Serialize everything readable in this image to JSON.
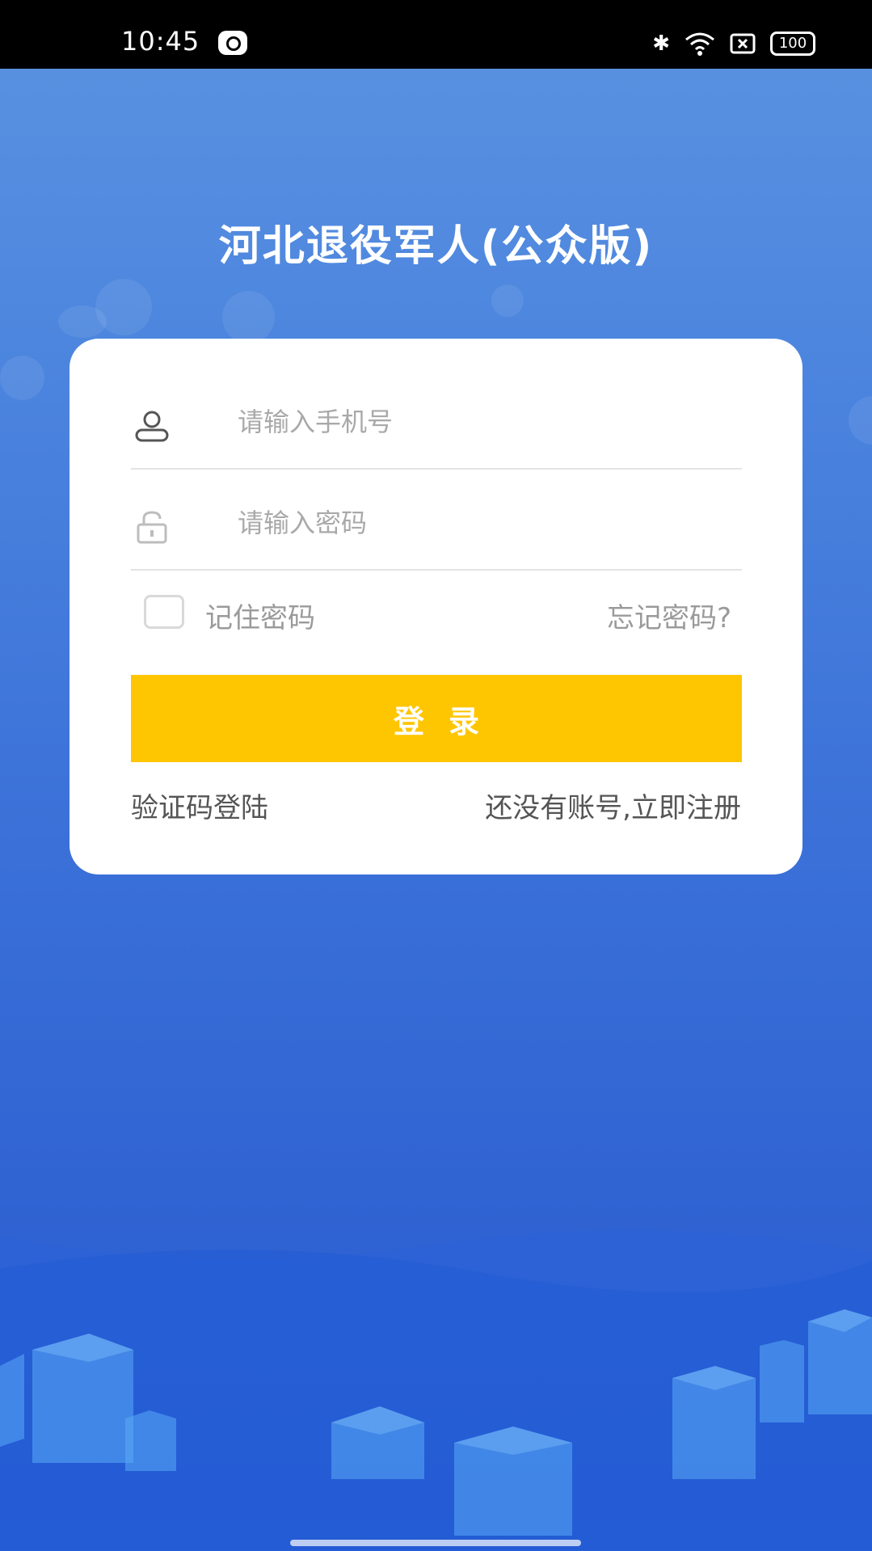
{
  "status_bar": {
    "time": "10:45",
    "battery": "100",
    "icons": [
      "app-notification-icon",
      "bluetooth-icon",
      "wifi-icon",
      "sim-off-icon",
      "battery-icon"
    ]
  },
  "app": {
    "title": "河北退役军人(公众版)"
  },
  "login_form": {
    "phone_placeholder": "请输入手机号",
    "password_placeholder": "请输入密码",
    "remember_label": "记住密码",
    "forgot_label": "忘记密码?",
    "login_button": "登录",
    "sms_login": "验证码登陆",
    "register": "还没有账号,立即注册"
  },
  "colors": {
    "accent_button": "#fec601",
    "background_top": "#5b93e1",
    "background_bottom": "#2a5ccf"
  }
}
